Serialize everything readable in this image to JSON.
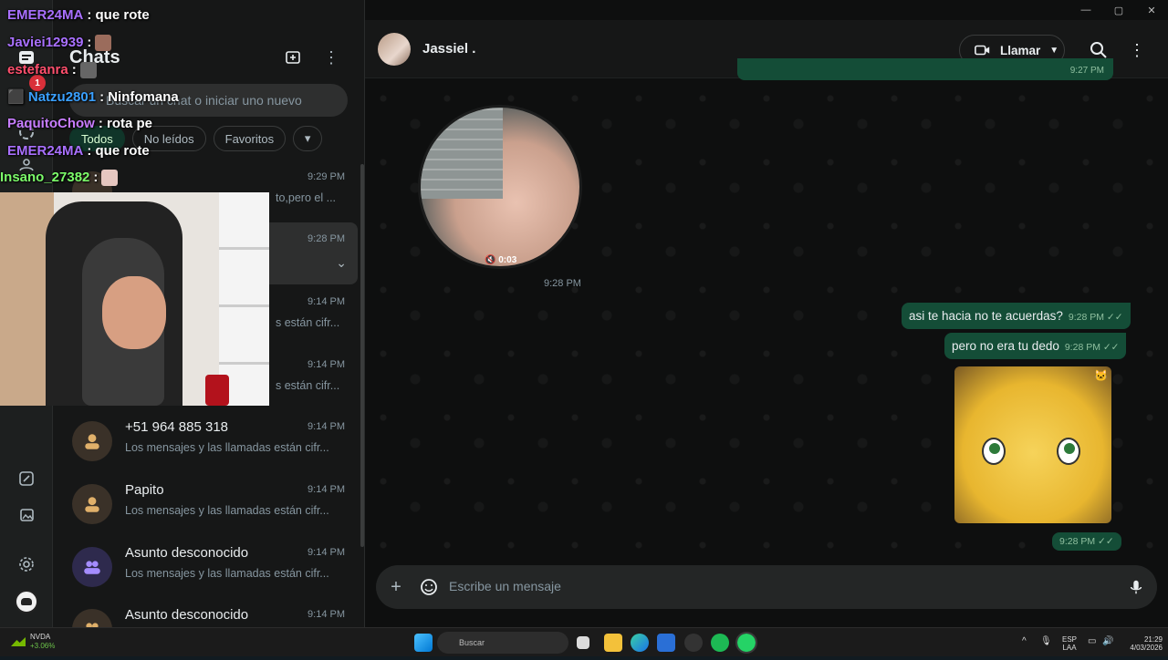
{
  "window": {
    "controls": [
      "—",
      "▢",
      "✕"
    ]
  },
  "rail": {
    "badge": "1"
  },
  "chatlist": {
    "title": "Chats",
    "search_placeholder": "Buscar un chat o iniciar uno nuevo",
    "filters": [
      "Todos",
      "No leídos",
      "Favoritos"
    ],
    "items": [
      {
        "name": "",
        "time": "9:29 PM",
        "preview": "to,pero el ..."
      },
      {
        "name": "",
        "time": "9:28 PM",
        "preview": ""
      },
      {
        "name": "",
        "time": "9:14 PM",
        "preview": "s están cifr..."
      },
      {
        "name": "",
        "time": "9:14 PM",
        "preview": "s están cifr..."
      },
      {
        "name": "+51 964 885 318",
        "time": "9:14 PM",
        "preview": "Los mensajes y las llamadas están cifr..."
      },
      {
        "name": "Papito",
        "time": "9:14 PM",
        "preview": "Los mensajes y las llamadas están cifr..."
      },
      {
        "name": "Asunto desconocido",
        "time": "9:14 PM",
        "preview": "Los mensajes y las llamadas están cifr..."
      },
      {
        "name": "Asunto desconocido",
        "time": "9:14 PM",
        "preview": ""
      }
    ]
  },
  "conversation": {
    "contact_name": "Jassiel .",
    "call_label": "Llamar",
    "top_bubble_time": "9:27 PM",
    "video_note": {
      "duration": "0:03",
      "time": "9:28 PM"
    },
    "messages": [
      {
        "text": "asi te hacia no te acuerdas?",
        "time": "9:28 PM"
      },
      {
        "text": "pero no era tu dedo",
        "time": "9:28 PM"
      }
    ],
    "sticker_time": "9:28 PM",
    "composer_placeholder": "Escribe un mensaje"
  },
  "overlay_chat": [
    {
      "user": "EMER24MA",
      "msg": ": que rote",
      "color": "#a970ff"
    },
    {
      "user": "Javiei12939",
      "msg": ":",
      "color": "#a970ff"
    },
    {
      "user": "estefanra",
      "msg": ":",
      "color": "#ff4f6d"
    },
    {
      "user": "Natzu2801",
      "msg": ": Ninfomana",
      "color": "#3aa0ff"
    },
    {
      "user": "PaquitoChow",
      "msg": ": rota pe",
      "color": "#c77dff"
    },
    {
      "user": "EMER24MA",
      "msg": ": que rote",
      "color": "#a970ff"
    },
    {
      "user": "Insano_27382",
      "msg": ":",
      "color": "#7cfc6a"
    }
  ],
  "taskbar": {
    "nvda_label": "NVDA",
    "nvda_change": "+3.06%",
    "search_label": "Buscar",
    "lang_top": "ESP",
    "lang_bottom": "LAA",
    "clock_time": "21:29",
    "clock_date": "4/03/2026"
  },
  "colors": {
    "accent": "#144d37",
    "active_chip": "#103529",
    "badge": "#d9303a"
  }
}
